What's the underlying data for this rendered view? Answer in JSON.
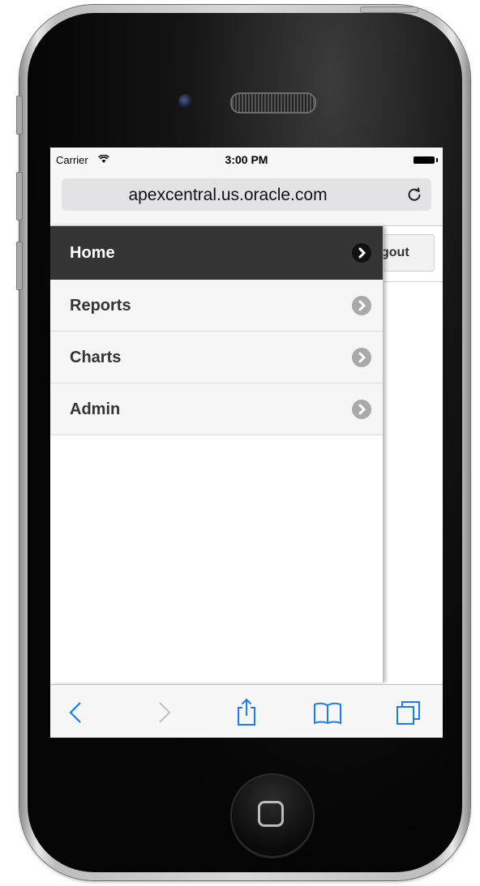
{
  "status_bar": {
    "carrier": "Carrier",
    "time": "3:00 PM"
  },
  "browser": {
    "url": "apexcentral.us.oracle.com",
    "reload_icon": "reload-icon"
  },
  "page": {
    "logout_label": "gout"
  },
  "nav": {
    "items": [
      {
        "label": "Home",
        "active": true
      },
      {
        "label": "Reports",
        "active": false
      },
      {
        "label": "Charts",
        "active": false
      },
      {
        "label": "Admin",
        "active": false
      }
    ]
  },
  "toolbar": {
    "icons": [
      "back-icon",
      "forward-icon",
      "share-icon",
      "bookmarks-icon",
      "tabs-icon"
    ],
    "accent": "#1a7cf5",
    "disabled": "#c4c4c4"
  },
  "colors": {
    "active_nav": "#353535",
    "nav_bg": "#f6f6f6",
    "arrow_inactive": "#a9a9a9"
  }
}
